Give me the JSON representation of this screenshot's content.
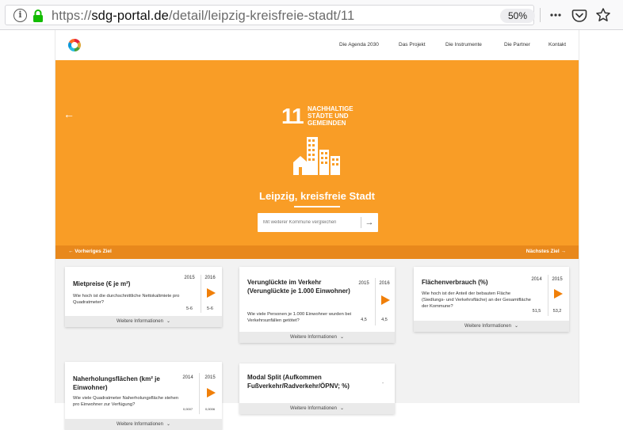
{
  "browser": {
    "url_prefix": "https://",
    "url_host": "sdg-portal.de",
    "url_path": "/detail/leipzig-kreisfreie-stadt/11",
    "zoom": "50%",
    "menu_icon": "ellipsis-icon",
    "pocket_icon": "pocket-icon",
    "bookmark_icon": "star-icon"
  },
  "nav": {
    "links": [
      "Die Agenda 2030",
      "Das Projekt",
      "Die Instrumente",
      "Die Partner",
      "Kontakt"
    ]
  },
  "hero": {
    "goal_number": "11",
    "goal_title": "Nachhaltige Städte und Gemeinden",
    "city": "Leipzig, kreisfreie Stadt",
    "compare_placeholder": "Mit weiterer Kommune vergleichen",
    "color": "#f99d26"
  },
  "goalbar": {
    "prev": "←  Vorheriges Ziel",
    "next": "Nächstes Ziel  →"
  },
  "cards": [
    {
      "title": "Mietpreise (€ je m²)",
      "desc": "Wie hoch ist die durchschnittliche Nettokaltmiete pro Quadratmeter?",
      "year1": "2015",
      "year2": "2016",
      "val1": "5-6",
      "val2": "5-6",
      "more": "Weitere Informationen"
    },
    {
      "title": "Verunglückte im Verkehr (Verunglückte je 1.000 Einwohner)",
      "desc": "Wie viele Personen je 1.000 Einwohner wurden bei Verkehrsunfällen getötet?",
      "year1": "2015",
      "year2": "2016",
      "val1": "4,5",
      "val2": "4,5",
      "more": "Weitere Informationen"
    },
    {
      "title": "Flächenverbrauch (%)",
      "desc": "Wie hoch ist der Anteil der bebauten Fläche (Siedlungs- und Verkehrsfläche) an der Gesamtfläche der Kommune?",
      "year1": "2014",
      "year2": "2015",
      "val1": "51,5",
      "val2": "53,2",
      "more": "Weitere Informationen"
    },
    {
      "title": "Naherholungsflächen (km² je Einwohner)",
      "desc": "Wie viele Quadratmeter Naherholungsfläche stehen pro Einwohner zur Verfügung?",
      "year1": "2014",
      "year2": "2015",
      "val1": "0,0007",
      "val2": "0,0006",
      "more": "Weitere Informationen"
    },
    {
      "title": "Modal Split (Aufkommen Fußverkehr/Radverkehr/ÖPNV; %)",
      "desc": "",
      "dash": "-",
      "more": "Weitere Informationen"
    }
  ]
}
